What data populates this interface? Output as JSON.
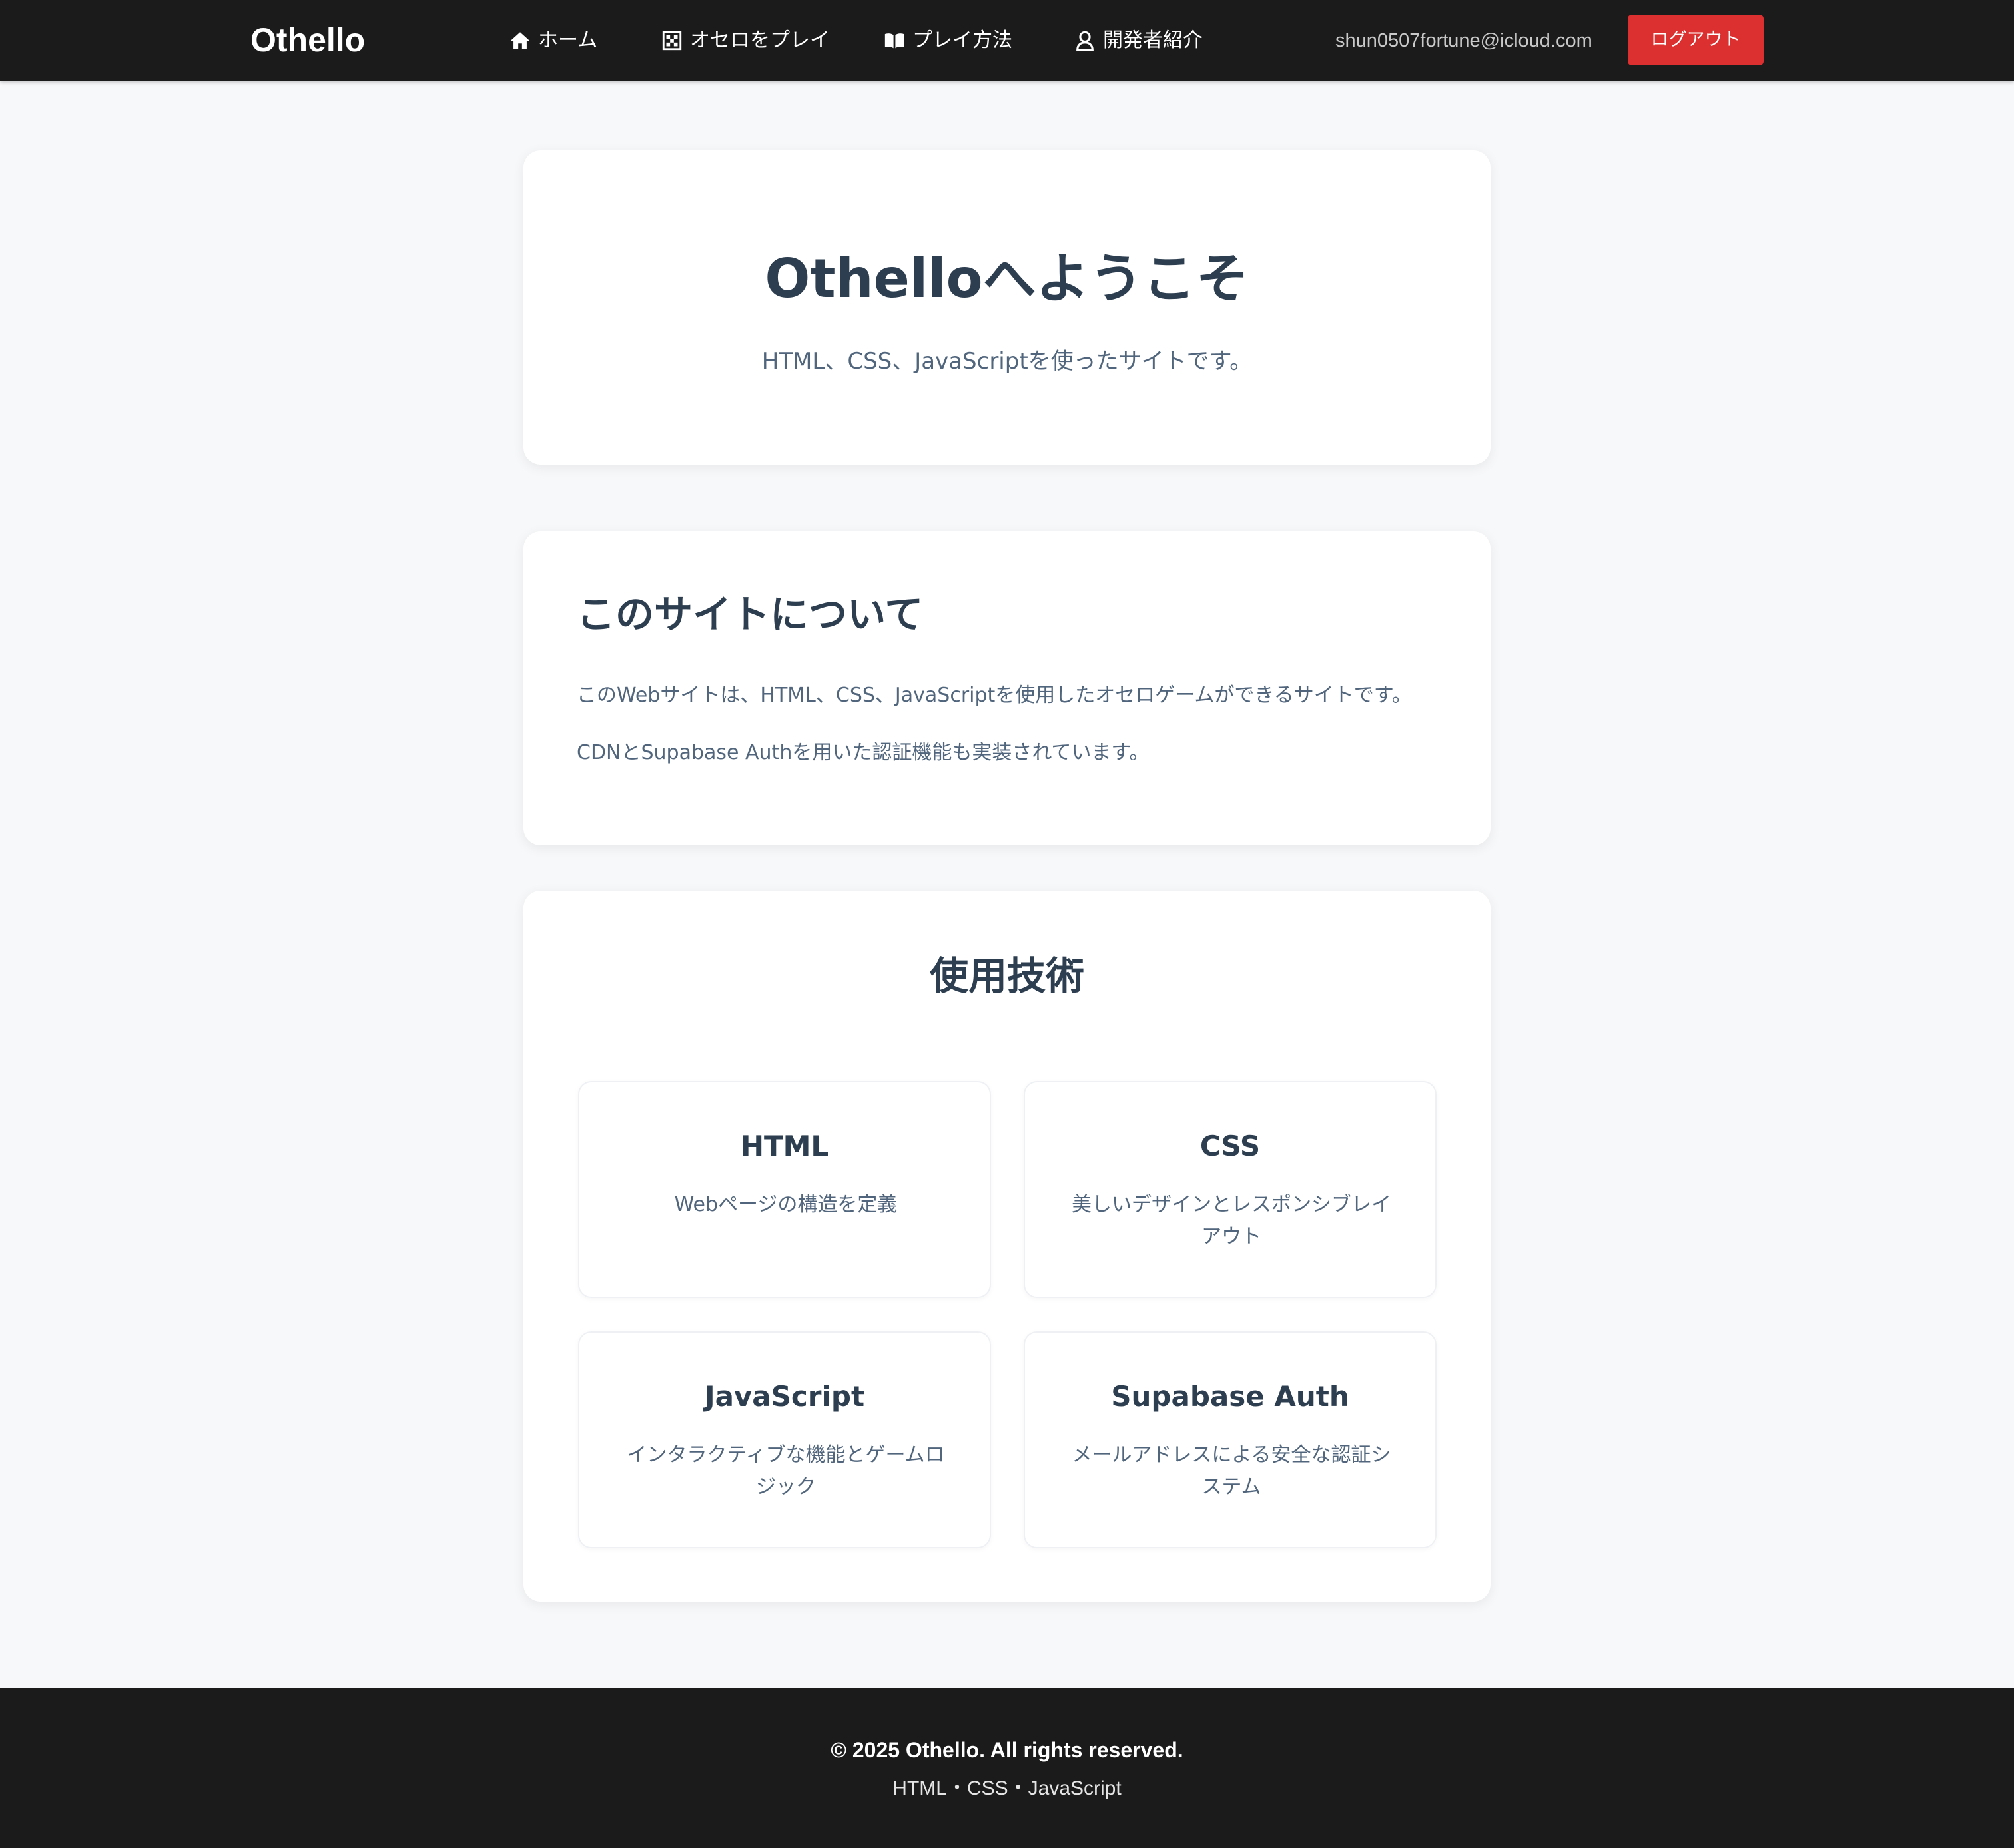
{
  "header": {
    "brand": "Othello",
    "nav": [
      {
        "label": "ホーム",
        "icon": "home-icon"
      },
      {
        "label": "オセロをプレイ",
        "icon": "board-icon"
      },
      {
        "label": "プレイ方法",
        "icon": "book-icon"
      },
      {
        "label": "開発者紹介",
        "icon": "user-icon"
      }
    ],
    "user_email": "shun0507fortune@icloud.com",
    "logout_label": "ログアウト"
  },
  "hero": {
    "title": "Othelloへようこそ",
    "subtitle": "HTML、CSS、JavaScriptを使ったサイトです。"
  },
  "about": {
    "title": "このサイトについて",
    "paragraphs": [
      "このWebサイトは、HTML、CSS、JavaScriptを使用したオセロゲームができるサイトです。",
      "CDNとSupabase Authを用いた認証機能も実装されています。"
    ]
  },
  "tech": {
    "title": "使用技術",
    "items": [
      {
        "name": "HTML",
        "desc": "Webページの構造を定義"
      },
      {
        "name": "CSS",
        "desc": "美しいデザインとレスポンシブレイアウト"
      },
      {
        "name": "JavaScript",
        "desc": "インタラクティブな機能とゲームロジック"
      },
      {
        "name": "Supabase Auth",
        "desc": "メールアドレスによる安全な認証システム"
      }
    ]
  },
  "footer": {
    "copyright": "© 2025 Othello. All rights reserved.",
    "tech": "HTML・CSS・JavaScript"
  },
  "colors": {
    "header_bg": "#1b1b1b",
    "page_bg": "#f7f8fa",
    "heading": "#2d3e50",
    "body_text": "#51667d",
    "logout_button": "#dc2f2f"
  }
}
